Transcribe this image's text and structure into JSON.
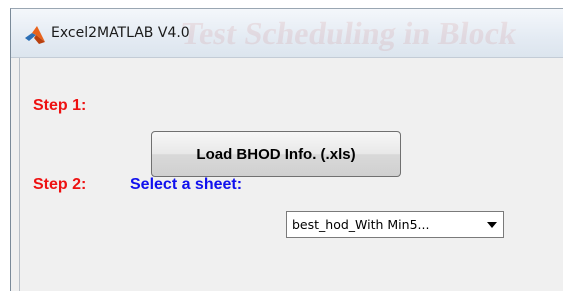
{
  "window": {
    "title": "Excel2MATLAB V4.0",
    "app_icon": "matlab-logo-icon",
    "background_text": "Test Scheduling in Block"
  },
  "step1": {
    "label": "Step 1:",
    "button_label": "Load BHOD Info. (.xls)"
  },
  "step2": {
    "label": "Step 2:",
    "select_label": "Select a sheet:",
    "selected_value": "best_hod_With Min5...",
    "arrow_icon": "chevron-down-icon"
  },
  "colors": {
    "step_label": "#ee1111",
    "select_label": "#1111ee",
    "background": "#f0f0f0"
  }
}
